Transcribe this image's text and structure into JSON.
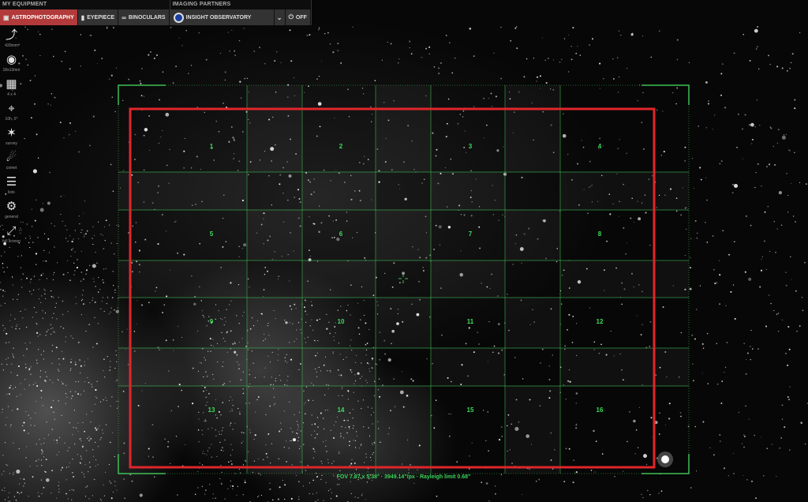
{
  "topbar": {
    "equipment_title": "MY EQUIPMENT",
    "partners_title": "IMAGING PARTNERS",
    "buttons": [
      {
        "label": "ASTROPHOTOGRAPHY",
        "icon": "camera-icon",
        "active": true
      },
      {
        "label": "EYEPIECE",
        "icon": "eyepiece-icon",
        "active": false
      },
      {
        "label": "BINOCULARS",
        "icon": "binoculars-icon",
        "active": false
      }
    ],
    "partner": {
      "label": "INSIGHT OBSERVATORY",
      "icon": "observatory-logo"
    },
    "dropdown_icon": "chevron-down-icon",
    "power": {
      "label": "OFF",
      "icon": "power-icon"
    }
  },
  "sidebar": [
    {
      "icon": "telescope-icon",
      "label": "430mm"
    },
    {
      "icon": "camera-icon",
      "label": "18x13mm"
    },
    {
      "icon": "mosaic-grid-icon",
      "label": "4 x 4"
    },
    {
      "icon": "crosshair-icon",
      "label": "10h, 0°"
    },
    {
      "icon": "survey-icon",
      "label": "survey"
    },
    {
      "icon": "comet-icon",
      "label": "comet"
    },
    {
      "icon": "list-icon",
      "label": "lists"
    },
    {
      "icon": "gear-icon",
      "label": "general"
    },
    {
      "icon": "fullscreen-icon",
      "label": "full screen"
    }
  ],
  "mosaic": {
    "rows": 4,
    "cols": 4,
    "panel_labels": [
      "1",
      "2",
      "3",
      "4",
      "5",
      "6",
      "7",
      "8",
      "9",
      "10",
      "11",
      "12",
      "13",
      "14",
      "15",
      "16"
    ],
    "frame_color": "#e0262b",
    "grid_color": "#3fbf55",
    "label_color": "#3ddc5c"
  },
  "fov_text": "FOV 7.87 x 5.38° · 3949.14\"/px · Rayleigh limit 0.68\""
}
